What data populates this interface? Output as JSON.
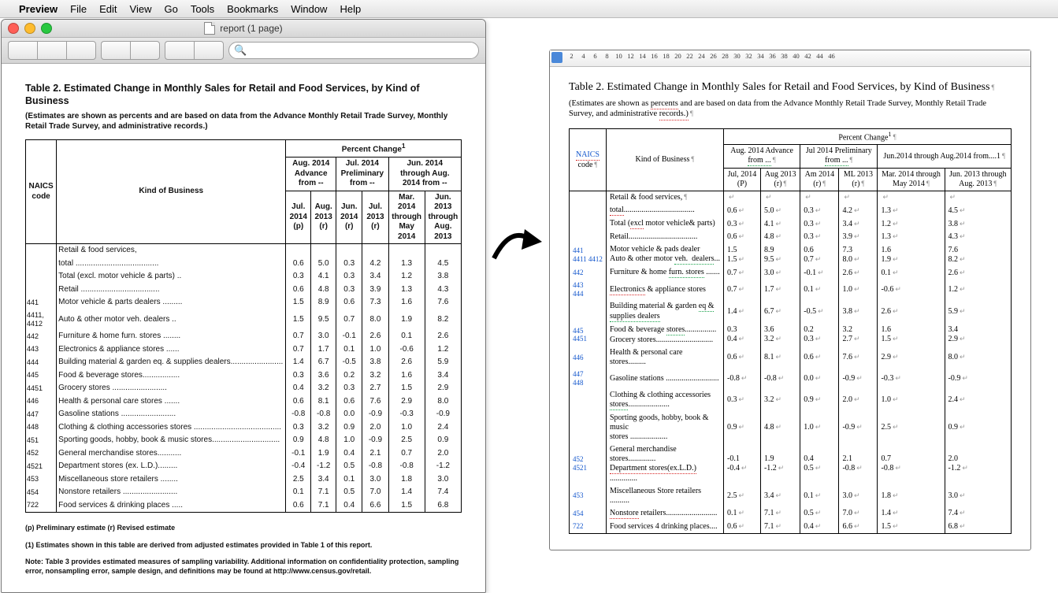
{
  "menubar": [
    "Preview",
    "File",
    "Edit",
    "View",
    "Go",
    "Tools",
    "Bookmarks",
    "Window",
    "Help"
  ],
  "window_title": "report  (1 page)",
  "search_placeholder": "",
  "table_title": "Table 2.  Estimated Change in Monthly Sales for Retail and Food Services, by Kind of Business",
  "table_sub": "(Estimates are shown as percents and are based on data from the Advance Monthly Retail Trade Survey, Monthly Retail Trade Survey, and administrative records.)",
  "header": {
    "naics": "NAICS code",
    "kob": "Kind of Business",
    "pc": "Percent Change",
    "pc_sup": "1",
    "grp1": "Aug. 2014 Advance from --",
    "grp2": "Jul. 2014 Preliminary from --",
    "grp3": "Jun. 2014 through Aug. 2014 from --",
    "c1": "Jul. 2014 (p)",
    "c2": "Aug. 2013 (r)",
    "c3": "Jun. 2014 (r)",
    "c4": "Jul. 2013 (r)",
    "c5": "Mar. 2014 through May 2014",
    "c6": "Jun. 2013 through Aug. 2013"
  },
  "rows": [
    {
      "code": "",
      "kob": "Retail & food services,",
      "v": [
        "",
        "",
        "",
        "",
        "",
        ""
      ]
    },
    {
      "code": "",
      "kob": "  total ......................................",
      "v": [
        "0.6",
        "5.0",
        "0.3",
        "4.2",
        "1.3",
        "4.5"
      ]
    },
    {
      "code": "",
      "kob": "  Total (excl. motor vehicle & parts) ..",
      "v": [
        "0.3",
        "4.1",
        "0.3",
        "3.4",
        "1.2",
        "3.8"
      ]
    },
    {
      "code": "",
      "kob": "  Retail ....................................",
      "v": [
        "0.6",
        "4.8",
        "0.3",
        "3.9",
        "1.3",
        "4.3"
      ]
    },
    {
      "code": "441",
      "kob": "Motor vehicle & parts dealers .........",
      "v": [
        "1.5",
        "8.9",
        "0.6",
        "7.3",
        "1.6",
        "7.6"
      ]
    },
    {
      "code": "4411, 4412",
      "kob": "  Auto & other motor veh. dealers ..",
      "v": [
        "1.5",
        "9.5",
        "0.7",
        "8.0",
        "1.9",
        "8.2"
      ]
    },
    {
      "code": "442",
      "kob": "Furniture & home furn. stores ........",
      "v": [
        "0.7",
        "3.0",
        "-0.1",
        "2.6",
        "0.1",
        "2.6"
      ]
    },
    {
      "code": "443",
      "kob": "Electronics & appliance stores ......",
      "v": [
        "0.7",
        "1.7",
        "0.1",
        "1.0",
        "-0.6",
        "1.2"
      ]
    },
    {
      "code": "444",
      "kob": "Building material & garden eq. & supplies dealers........................",
      "v": [
        "1.4",
        "6.7",
        "-0.5",
        "3.8",
        "2.6",
        "5.9"
      ]
    },
    {
      "code": "445",
      "kob": "Food & beverage stores.................",
      "v": [
        "0.3",
        "3.6",
        "0.2",
        "3.2",
        "1.6",
        "3.4"
      ]
    },
    {
      "code": "4451",
      "kob": "  Grocery stores .........................",
      "v": [
        "0.4",
        "3.2",
        "0.3",
        "2.7",
        "1.5",
        "2.9"
      ]
    },
    {
      "code": "446",
      "kob": "Health & personal care stores .......",
      "v": [
        "0.6",
        "8.1",
        "0.6",
        "7.6",
        "2.9",
        "8.0"
      ]
    },
    {
      "code": "447",
      "kob": "Gasoline stations .........................",
      "v": [
        "-0.8",
        "-0.8",
        "0.0",
        "-0.9",
        "-0.3",
        "-0.9"
      ]
    },
    {
      "code": "448",
      "kob": "Clothing & clothing accessories stores ........................................",
      "v": [
        "0.3",
        "3.2",
        "0.9",
        "2.0",
        "1.0",
        "2.4"
      ]
    },
    {
      "code": "451",
      "kob": "Sporting goods, hobby, book & music stores...............................",
      "v": [
        "0.9",
        "4.8",
        "1.0",
        "-0.9",
        "2.5",
        "0.9"
      ]
    },
    {
      "code": "452",
      "kob": "General merchandise stores...........",
      "v": [
        "-0.1",
        "1.9",
        "0.4",
        "2.1",
        "0.7",
        "2.0"
      ]
    },
    {
      "code": "4521",
      "kob": "  Department stores (ex. L.D.).........",
      "v": [
        "-0.4",
        "-1.2",
        "0.5",
        "-0.8",
        "-0.8",
        "-1.2"
      ]
    },
    {
      "code": "453",
      "kob": "Miscellaneous store retailers ........",
      "v": [
        "2.5",
        "3.4",
        "0.1",
        "3.0",
        "1.8",
        "3.0"
      ]
    },
    {
      "code": "454",
      "kob": "Nonstore retailers .........................",
      "v": [
        "0.1",
        "7.1",
        "0.5",
        "7.0",
        "1.4",
        "7.4"
      ]
    },
    {
      "code": "722",
      "kob": "Food services & drinking places .....",
      "v": [
        "0.6",
        "7.1",
        "0.4",
        "6.6",
        "1.5",
        "6.8"
      ]
    }
  ],
  "foot1": "(p)  Preliminary estimate      (r)  Revised estimate",
  "foot2": "(1)  Estimates shown in this table are derived from adjusted estimates provided  in Table 1 of this report.",
  "foot3": "Note:  Table 3 provides estimated measures of sampling variability.  Additional information on confidentiality protection, sampling error, nonsampling error, sample design, and definitions may be found at  http://www.census.gov/retail.",
  "word_title": "Table 2. Estimated Change in Monthly Sales for Retail and Food Services, by Kind of Business",
  "word_header": {
    "grp1a": "Aug. 2014 Advance",
    "grp2a": "Jul 2014 Preliminary",
    "grp3a": "Jun.2014 through Aug.2014 from....1",
    "from": "from ... ",
    "c1": "Jul, 2014 (P)",
    "c2": "Aug 2013 (r)",
    "c3": "Am 2014 (r)",
    "c4": "ML 2013 (r)",
    "c5": "Mar. 2014 through May 2014",
    "c6": "Jun. 2013 through Aug. 2013"
  },
  "word_rows_html": [
    {
      "code": "",
      "kob": "Retail & food services,",
      "pil": true,
      "v": [
        "",
        "",
        "",
        "",
        "",
        ""
      ]
    },
    {
      "code": "",
      "kob": "<span class='squig-r'>total</span>....................................",
      "v": [
        "0.6",
        "5.0",
        "0.3",
        "4.2",
        "1.3",
        "4.5"
      ]
    },
    {
      "code": "",
      "kob": "Total (<span class='squig-r'>excl</span> motor vehicle& parts)",
      "v": [
        "0.3",
        "4.1",
        "0.3",
        "3.4",
        "1.2",
        "3.8"
      ]
    },
    {
      "code": "",
      "kob": "Retail...................................",
      "v": [
        "0.6",
        "4.8",
        "0.3",
        "3.9",
        "1.3",
        "4.3"
      ]
    },
    {
      "code": "<span class='lnk'>441</span><br><span class='lnk'>4411 4412</span>",
      "kob": "Motor vehicle & pads dealer<br>Auto & other motor <span class='squig-g'>veh.&nbsp;&nbsp;dealers</span>...",
      "v": [
        "1.5<br>1.5",
        "8.9<br>9.5",
        "0.6<br>0.7",
        "7.3<br>8.0",
        "1.6<br>1.9",
        "7.6<br>8.2"
      ]
    },
    {
      "code": "<span class='lnk'>442</span>",
      "kob": "Furniture & home <span class='squig-g'>furn.&nbsp;stores</span> .......",
      "v": [
        "0.7",
        "3.0",
        "-0.1",
        "2.6",
        "0.1",
        "2.6"
      ]
    },
    {
      "code": "<span class='lnk'>443</span><br><span class='lnk'>444</span>",
      "kob": "<span class='squig-r'>Electronics</span> & appliance stores",
      "v": [
        "0.7",
        "1.7",
        "0.1",
        "1.0",
        "-0.6",
        "1.2"
      ]
    },
    {
      "code": "",
      "kob": "Building material & garden <span class='squig-g'>eq &</span><br><span class='squig-g'>supplies dealers</span>",
      "v": [
        "1.4",
        "6.7",
        "-0.5",
        "3.8",
        "2.6",
        "5.9"
      ]
    },
    {
      "code": "<span class='lnk'>445</span><br><span class='lnk'>4451</span>",
      "kob": "Food & beverage <span class='squig-g'>stores</span>................<br>Grocery stores.............................",
      "v": [
        "0.3<br>0.4",
        "3.6<br>3.2",
        "0.2<br>0.3",
        "3.2<br>2.7",
        "1.6<br>1.5",
        "3.4<br>2.9"
      ]
    },
    {
      "code": "<span class='lnk'>446</span>",
      "kob": "Health & personal care stores.........",
      "v": [
        "0.6",
        "8.1",
        "0.6",
        "7.6",
        "2.9",
        "8.0"
      ]
    },
    {
      "code": "<span class='lnk'>447</span><br><span class='lnk'>448</span>",
      "kob": "Gasoline stations ...........................",
      "v": [
        "-0.8",
        "-0.8",
        "0.0",
        "-0.9",
        "-0.3",
        "-0.9"
      ]
    },
    {
      "code": "",
      "kob": "Clothing & clothing accessories<br><span class='squig-g'>stores</span>.....................",
      "v": [
        "0.3",
        "3.2",
        "0.9",
        "2.0",
        "1.0",
        "2.4"
      ]
    },
    {
      "code": "",
      "kob": "Sporting goods, hobby, book & music<br>stores ...................",
      "v": [
        "0.9",
        "4.8",
        "1.0",
        "-0.9",
        "2.5",
        "0.9"
      ]
    },
    {
      "code": "<span class='lnk'>452</span><br><span class='lnk'>4521</span>",
      "kob": "General merchandise stores..............<br><span class='squig-r'>Department stores(ex.L.D.)</span>..............",
      "v": [
        "-0.1<br>-0.4",
        "1.9<br>-1.2",
        "0.4<br>0.5",
        "2.1<br>-0.8",
        "0.7<br>-0.8",
        "2.0<br>-1.2"
      ]
    },
    {
      "code": "<span class='lnk'>453</span>",
      "kob": "Miscellaneous Store retailers ..........",
      "v": [
        "2.5",
        "3.4",
        "0.1",
        "3.0",
        "1.8",
        "3.0"
      ]
    },
    {
      "code": "<span class='lnk'>454</span>",
      "kob": "<span class='squig-r'>Nonstore</span> retailers..........................",
      "v": [
        "0.1",
        "7.1",
        "0.5",
        "7.0",
        "1.4",
        "7.4"
      ]
    },
    {
      "code": "<span class='lnk'>722</span>",
      "kob": "Food services 4 drinking places....",
      "v": [
        "0.6",
        "7.1",
        "0.4",
        "6.6",
        "1.5",
        "6.8"
      ]
    }
  ],
  "ruler_labels": [
    "2",
    "4",
    "6",
    "8",
    "10",
    "12",
    "14",
    "16",
    "18",
    "20",
    "22",
    "24",
    "26",
    "28",
    "30",
    "32",
    "34",
    "36",
    "38",
    "40",
    "42",
    "44",
    "46"
  ]
}
